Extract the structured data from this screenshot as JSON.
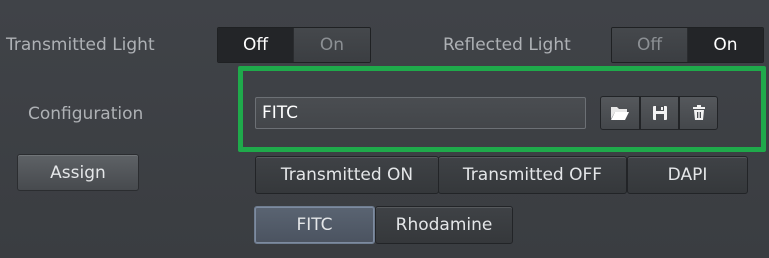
{
  "transmitted_light": {
    "label": "Transmitted Light",
    "options": [
      "Off",
      "On"
    ],
    "selected": "Off"
  },
  "reflected_light": {
    "label": "Reflected Light",
    "options": [
      "Off",
      "On"
    ],
    "selected": "On"
  },
  "configuration": {
    "label": "Configuration",
    "value": "FITC",
    "icons": [
      "folder-open-icon",
      "save-icon",
      "delete-icon"
    ]
  },
  "assign_button": "Assign",
  "presets": [
    "Transmitted ON",
    "Transmitted OFF",
    "DAPI",
    "FITC",
    "Rhodamine"
  ],
  "selected_preset": "FITC",
  "highlight_color": "#1faa4b"
}
